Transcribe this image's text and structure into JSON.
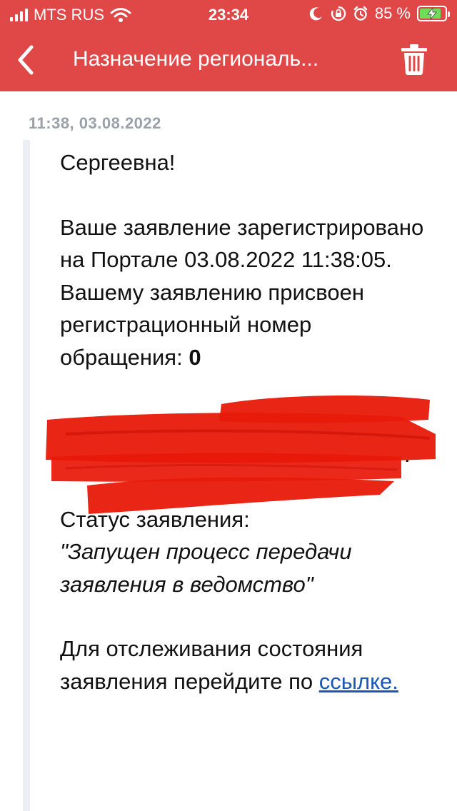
{
  "status_bar": {
    "carrier": "MTS RUS",
    "time": "23:34",
    "battery_percent": "85 %",
    "battery_level": 0.85,
    "icons": [
      "signal-icon",
      "wifi-icon",
      "moon-icon",
      "rotation-lock-icon",
      "alarm-icon",
      "battery-charging-icon"
    ]
  },
  "nav": {
    "title": "Назначение региональ...",
    "back_icon": "chevron-left-icon",
    "delete_icon": "trash-icon"
  },
  "message": {
    "timestamp": "11:38, 03.08.2022",
    "greeting_tail": "Сергеевна!",
    "registration_text": "Ваше заявление зарегистрировано на Портале 03.08.2022 11:38:05. Вашему заявлению присвоен регистрационный номер обращения: ",
    "number_visible_start": "0",
    "number_visible_end": ".",
    "status_label": "Статус заявления:",
    "status_value": "\"Запущен процесс передачи заявления в ведомство\"",
    "tracking_text": "Для отслеживания состояния заявления перейдите по ",
    "link_text": "ссылке."
  },
  "colors": {
    "header_red": "#e04848",
    "link_blue": "#1a57b6",
    "timestamp_gray": "#9aa0a8",
    "redaction_red": "#e8190a",
    "battery_green": "#6fdc5a"
  }
}
